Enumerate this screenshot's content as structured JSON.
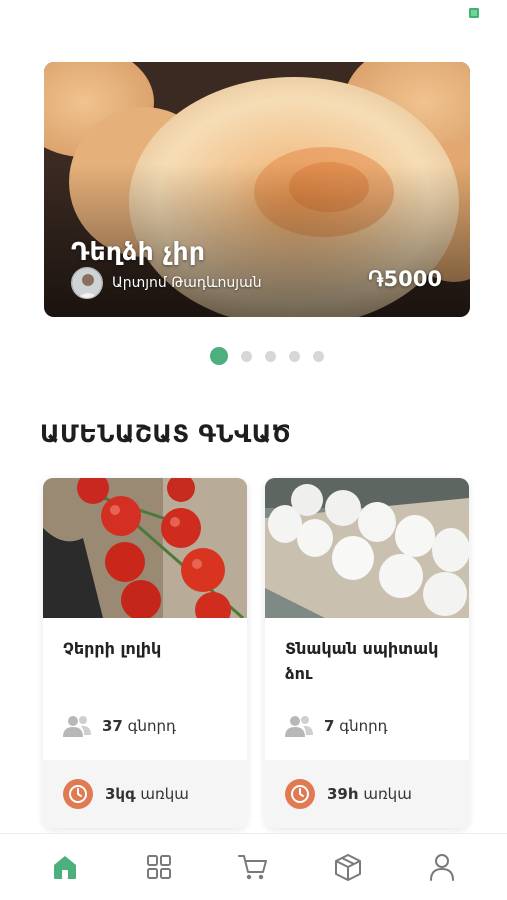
{
  "status": {
    "battery_color": "#3cb371"
  },
  "hero": {
    "title": "Դեղձի չիր",
    "seller": "Արտյոմ Թադևոսյան",
    "price": "֏5000"
  },
  "carousel": {
    "count": 5,
    "active_index": 0
  },
  "section": {
    "title": "ԱՄԵՆԱՇԱՏ ԳՆՎԱԾ"
  },
  "products": [
    {
      "name": "Չերրի լոլիկ",
      "buyers_count": "37",
      "buyers_label": "գնորդ",
      "stock_value": "3կգ",
      "stock_label": "առկա"
    },
    {
      "name": "Տնական սպիտակ ձու",
      "buyers_count": "7",
      "buyers_label": "գնորդ",
      "stock_value": "39h",
      "stock_label": "առկա"
    }
  ],
  "bottom_nav": [
    {
      "icon": "home-icon",
      "active": true
    },
    {
      "icon": "grid-icon",
      "active": false
    },
    {
      "icon": "cart-icon",
      "active": false
    },
    {
      "icon": "box-icon",
      "active": false
    },
    {
      "icon": "user-icon",
      "active": false
    }
  ],
  "colors": {
    "accent": "#4caf7d",
    "clock": "#e07a52",
    "nav_inactive": "#7a7a7a"
  }
}
